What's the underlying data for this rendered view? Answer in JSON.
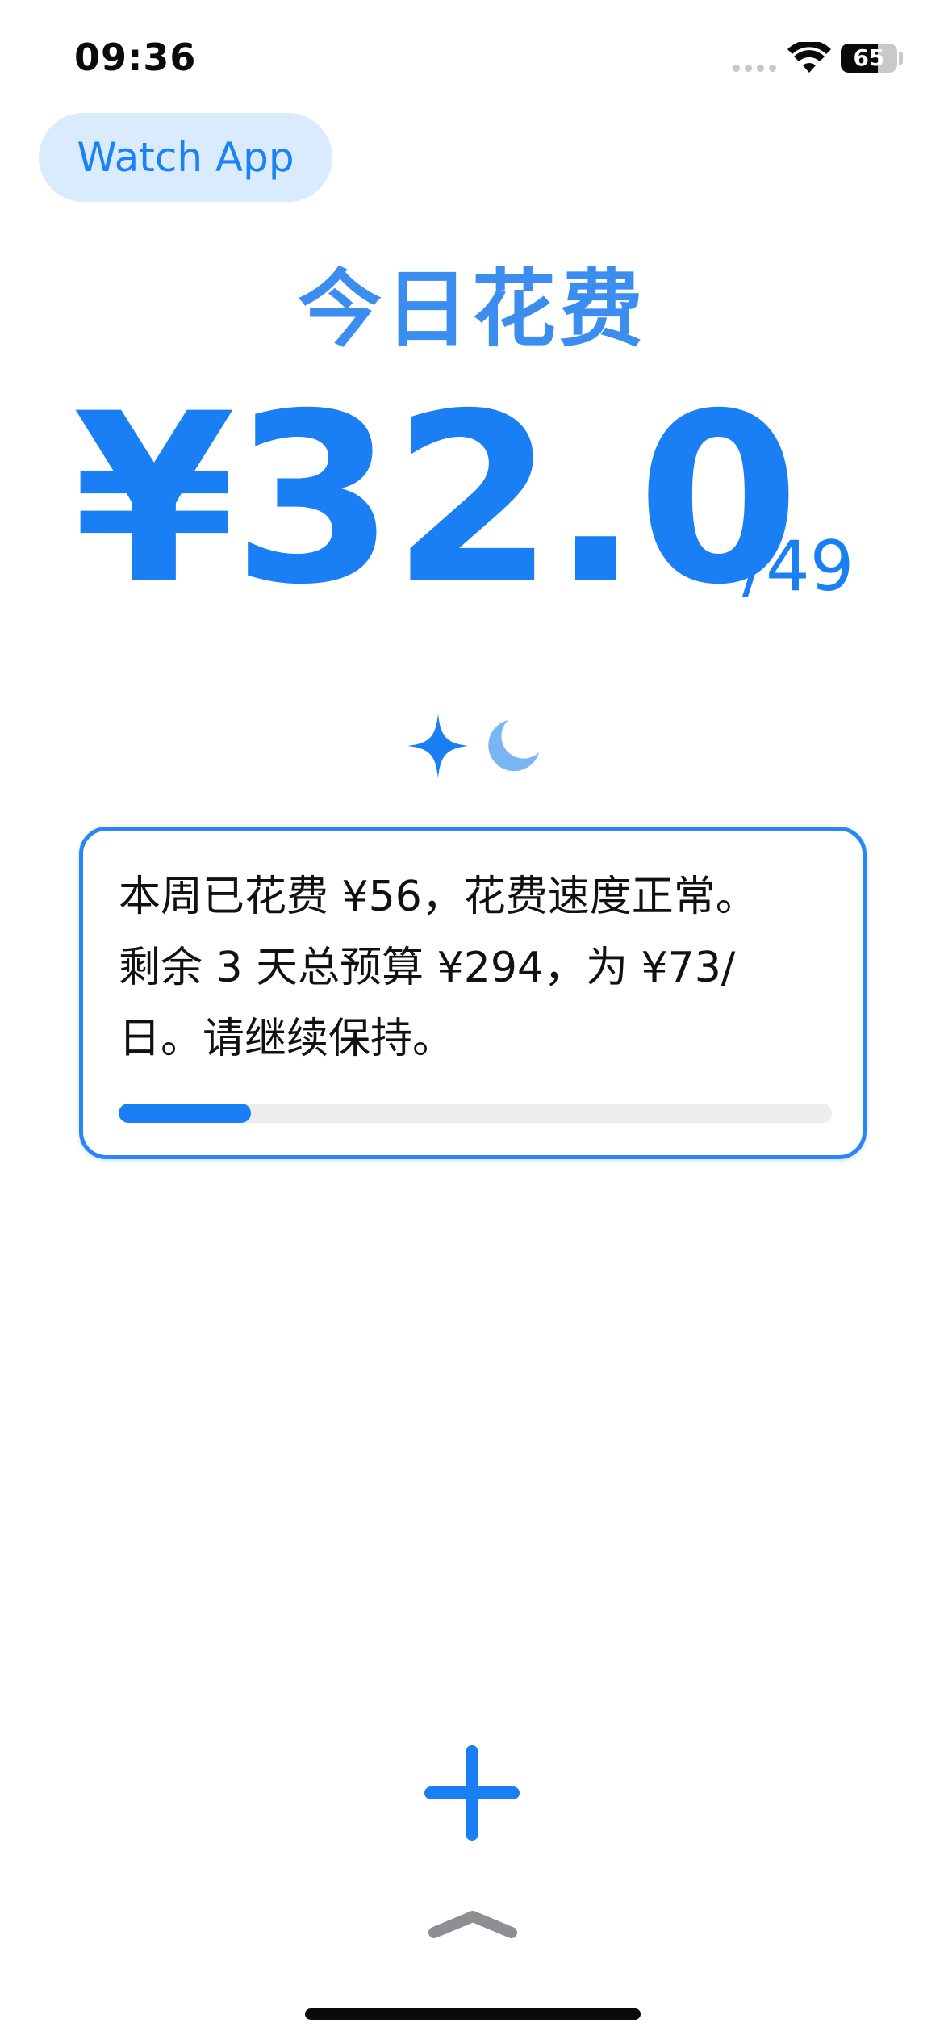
{
  "status_bar": {
    "time": "09:36",
    "battery_level": "65",
    "battery_fraction": 0.65
  },
  "header": {
    "watch_app_label": "Watch App"
  },
  "spending": {
    "title": "今日花费",
    "amount": "¥32.0",
    "budget": "/49"
  },
  "icons": {
    "sparkle": "sparkle-icon",
    "moon": "moon-icon",
    "add": "plus-icon",
    "chevron": "chevron-up-icon",
    "wifi": "wifi-icon",
    "signal": "cellular-signal-icon",
    "battery": "battery-icon"
  },
  "summary": {
    "line1": "本周已花费 ¥56，花费速度正常。",
    "line2": "剩余 3 天总预算 ¥294，为 ¥73/",
    "line3": "日。请继续保持。",
    "progress": 0.185
  },
  "colors": {
    "accent": "#1a7ff5",
    "title": "#3b8ef0",
    "pill_bg": "#d9ebfc",
    "moon": "#7ab6f5",
    "chevron": "#8e8e93"
  }
}
